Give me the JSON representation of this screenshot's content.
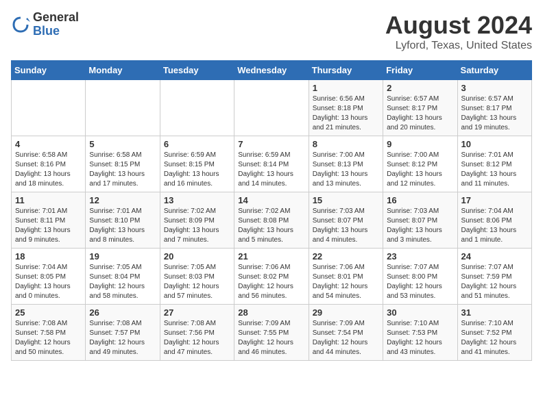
{
  "header": {
    "logo_line1": "General",
    "logo_line2": "Blue",
    "title": "August 2024",
    "subtitle": "Lyford, Texas, United States"
  },
  "days_of_week": [
    "Sunday",
    "Monday",
    "Tuesday",
    "Wednesday",
    "Thursday",
    "Friday",
    "Saturday"
  ],
  "weeks": [
    [
      {
        "day": "",
        "info": ""
      },
      {
        "day": "",
        "info": ""
      },
      {
        "day": "",
        "info": ""
      },
      {
        "day": "",
        "info": ""
      },
      {
        "day": "1",
        "info": "Sunrise: 6:56 AM\nSunset: 8:18 PM\nDaylight: 13 hours\nand 21 minutes."
      },
      {
        "day": "2",
        "info": "Sunrise: 6:57 AM\nSunset: 8:17 PM\nDaylight: 13 hours\nand 20 minutes."
      },
      {
        "day": "3",
        "info": "Sunrise: 6:57 AM\nSunset: 8:17 PM\nDaylight: 13 hours\nand 19 minutes."
      }
    ],
    [
      {
        "day": "4",
        "info": "Sunrise: 6:58 AM\nSunset: 8:16 PM\nDaylight: 13 hours\nand 18 minutes."
      },
      {
        "day": "5",
        "info": "Sunrise: 6:58 AM\nSunset: 8:15 PM\nDaylight: 13 hours\nand 17 minutes."
      },
      {
        "day": "6",
        "info": "Sunrise: 6:59 AM\nSunset: 8:15 PM\nDaylight: 13 hours\nand 16 minutes."
      },
      {
        "day": "7",
        "info": "Sunrise: 6:59 AM\nSunset: 8:14 PM\nDaylight: 13 hours\nand 14 minutes."
      },
      {
        "day": "8",
        "info": "Sunrise: 7:00 AM\nSunset: 8:13 PM\nDaylight: 13 hours\nand 13 minutes."
      },
      {
        "day": "9",
        "info": "Sunrise: 7:00 AM\nSunset: 8:12 PM\nDaylight: 13 hours\nand 12 minutes."
      },
      {
        "day": "10",
        "info": "Sunrise: 7:01 AM\nSunset: 8:12 PM\nDaylight: 13 hours\nand 11 minutes."
      }
    ],
    [
      {
        "day": "11",
        "info": "Sunrise: 7:01 AM\nSunset: 8:11 PM\nDaylight: 13 hours\nand 9 minutes."
      },
      {
        "day": "12",
        "info": "Sunrise: 7:01 AM\nSunset: 8:10 PM\nDaylight: 13 hours\nand 8 minutes."
      },
      {
        "day": "13",
        "info": "Sunrise: 7:02 AM\nSunset: 8:09 PM\nDaylight: 13 hours\nand 7 minutes."
      },
      {
        "day": "14",
        "info": "Sunrise: 7:02 AM\nSunset: 8:08 PM\nDaylight: 13 hours\nand 5 minutes."
      },
      {
        "day": "15",
        "info": "Sunrise: 7:03 AM\nSunset: 8:07 PM\nDaylight: 13 hours\nand 4 minutes."
      },
      {
        "day": "16",
        "info": "Sunrise: 7:03 AM\nSunset: 8:07 PM\nDaylight: 13 hours\nand 3 minutes."
      },
      {
        "day": "17",
        "info": "Sunrise: 7:04 AM\nSunset: 8:06 PM\nDaylight: 13 hours\nand 1 minute."
      }
    ],
    [
      {
        "day": "18",
        "info": "Sunrise: 7:04 AM\nSunset: 8:05 PM\nDaylight: 13 hours\nand 0 minutes."
      },
      {
        "day": "19",
        "info": "Sunrise: 7:05 AM\nSunset: 8:04 PM\nDaylight: 12 hours\nand 58 minutes."
      },
      {
        "day": "20",
        "info": "Sunrise: 7:05 AM\nSunset: 8:03 PM\nDaylight: 12 hours\nand 57 minutes."
      },
      {
        "day": "21",
        "info": "Sunrise: 7:06 AM\nSunset: 8:02 PM\nDaylight: 12 hours\nand 56 minutes."
      },
      {
        "day": "22",
        "info": "Sunrise: 7:06 AM\nSunset: 8:01 PM\nDaylight: 12 hours\nand 54 minutes."
      },
      {
        "day": "23",
        "info": "Sunrise: 7:07 AM\nSunset: 8:00 PM\nDaylight: 12 hours\nand 53 minutes."
      },
      {
        "day": "24",
        "info": "Sunrise: 7:07 AM\nSunset: 7:59 PM\nDaylight: 12 hours\nand 51 minutes."
      }
    ],
    [
      {
        "day": "25",
        "info": "Sunrise: 7:08 AM\nSunset: 7:58 PM\nDaylight: 12 hours\nand 50 minutes."
      },
      {
        "day": "26",
        "info": "Sunrise: 7:08 AM\nSunset: 7:57 PM\nDaylight: 12 hours\nand 49 minutes."
      },
      {
        "day": "27",
        "info": "Sunrise: 7:08 AM\nSunset: 7:56 PM\nDaylight: 12 hours\nand 47 minutes."
      },
      {
        "day": "28",
        "info": "Sunrise: 7:09 AM\nSunset: 7:55 PM\nDaylight: 12 hours\nand 46 minutes."
      },
      {
        "day": "29",
        "info": "Sunrise: 7:09 AM\nSunset: 7:54 PM\nDaylight: 12 hours\nand 44 minutes."
      },
      {
        "day": "30",
        "info": "Sunrise: 7:10 AM\nSunset: 7:53 PM\nDaylight: 12 hours\nand 43 minutes."
      },
      {
        "day": "31",
        "info": "Sunrise: 7:10 AM\nSunset: 7:52 PM\nDaylight: 12 hours\nand 41 minutes."
      }
    ]
  ]
}
